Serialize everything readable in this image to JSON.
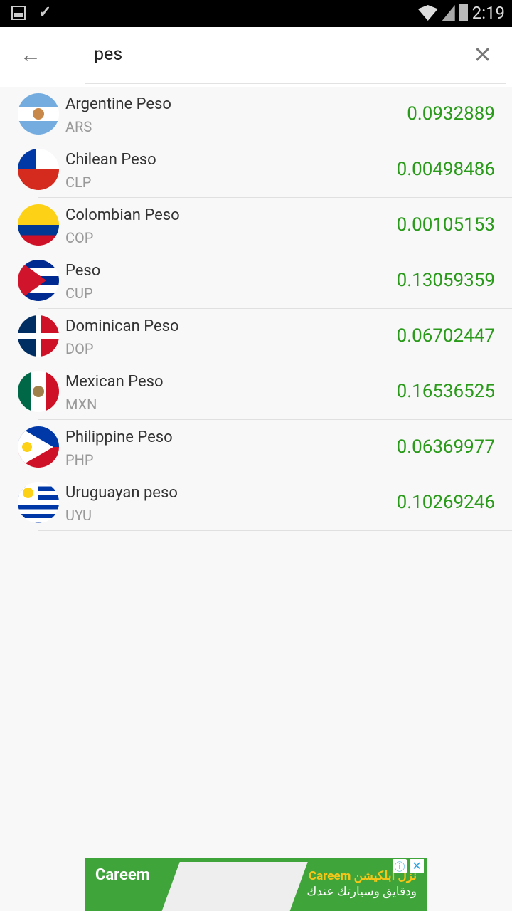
{
  "status_bar": {
    "time": "2:19"
  },
  "search": {
    "query": "pes"
  },
  "currencies": [
    {
      "name": "Argentine Peso",
      "code": "ARS",
      "rate": "0.0932889"
    },
    {
      "name": "Chilean Peso",
      "code": "CLP",
      "rate": "0.00498486"
    },
    {
      "name": "Colombian Peso",
      "code": "COP",
      "rate": "0.00105153"
    },
    {
      "name": "Peso",
      "code": "CUP",
      "rate": "0.13059359"
    },
    {
      "name": "Dominican Peso",
      "code": "DOP",
      "rate": "0.06702447"
    },
    {
      "name": "Mexican Peso",
      "code": "MXN",
      "rate": "0.16536525"
    },
    {
      "name": "Philippine Peso",
      "code": "PHP",
      "rate": "0.06369977"
    },
    {
      "name": "Uruguayan peso",
      "code": "UYU",
      "rate": "0.10269246"
    }
  ],
  "ad": {
    "brand": "Careem",
    "line1": "نزل ابلكيشن Careem",
    "line2": "ودقايق وسيارتك عندك"
  },
  "colors": {
    "rate": "#2a9a1a",
    "ad_bg": "#3fa53a"
  }
}
